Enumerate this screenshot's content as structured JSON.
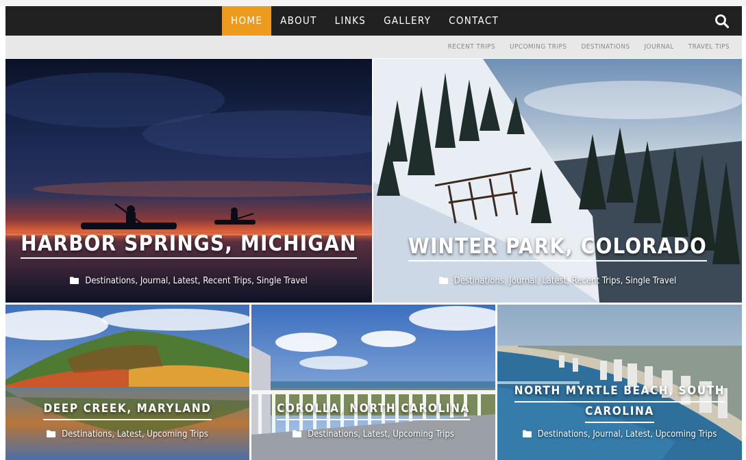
{
  "nav": {
    "items": [
      {
        "label": "HOME",
        "active": true
      },
      {
        "label": "ABOUT",
        "active": false
      },
      {
        "label": "LINKS",
        "active": false
      },
      {
        "label": "GALLERY",
        "active": false
      },
      {
        "label": "CONTACT",
        "active": false
      }
    ],
    "search_icon": "search-icon",
    "accent_color": "#ec9b1c"
  },
  "subnav": {
    "items": [
      "RECENT TRIPS",
      "UPCOMING TRIPS",
      "DESTINATIONS",
      "JOURNAL",
      "TRAVEL TIPS"
    ]
  },
  "posts": [
    {
      "title": "HARBOR SPRINGS, MICHIGAN",
      "categories": "Destinations, Journal, Latest, Recent Trips, Single Travel"
    },
    {
      "title": "WINTER PARK, COLORADO",
      "categories": "Destinations, Journal, Latest, Recent Trips, Single Travel"
    },
    {
      "title": "DEEP CREEK, MARYLAND",
      "categories": "Destinations, Latest, Upcoming Trips"
    },
    {
      "title": "COROLLA, NORTH CAROLINA",
      "categories": "Destinations, Latest, Upcoming Trips"
    },
    {
      "title_line1": "NORTH MYRTLE BEACH, SOUTH",
      "title_line2": "CAROLINA",
      "categories": "Destinations, Journal, Latest, Upcoming Trips"
    }
  ]
}
